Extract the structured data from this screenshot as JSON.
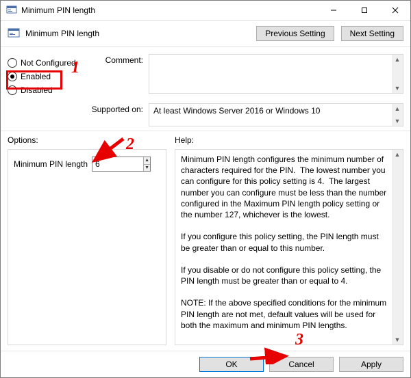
{
  "window": {
    "title": "Minimum PIN length"
  },
  "header": {
    "setting_name": "Minimum PIN length",
    "buttons": {
      "previous": "Previous Setting",
      "next": "Next Setting"
    }
  },
  "state": {
    "not_configured_label": "Not Configured",
    "enabled_label": "Enabled",
    "disabled_label": "Disabled",
    "selected": "enabled"
  },
  "middle": {
    "comment_label": "Comment:",
    "comment_value": "",
    "supported_label": "Supported on:",
    "supported_value": "At least Windows Server 2016 or Windows 10"
  },
  "lower": {
    "options_label": "Options:",
    "help_label": "Help:",
    "option_field_label": "Minimum PIN length",
    "option_field_value": "6",
    "help_text": "Minimum PIN length configures the minimum number of characters required for the PIN.  The lowest number you can configure for this policy setting is 4.  The largest number you can configure must be less than the number configured in the Maximum PIN length policy setting or the number 127, whichever is the lowest.\n\nIf you configure this policy setting, the PIN length must be greater than or equal to this number.\n\nIf you disable or do not configure this policy setting, the PIN length must be greater than or equal to 4.\n\nNOTE: If the above specified conditions for the minimum PIN length are not met, default values will be used for both the maximum and minimum PIN lengths."
  },
  "footer": {
    "ok": "OK",
    "cancel": "Cancel",
    "apply": "Apply"
  },
  "annotations": {
    "n1": "1",
    "n2": "2",
    "n3": "3"
  }
}
